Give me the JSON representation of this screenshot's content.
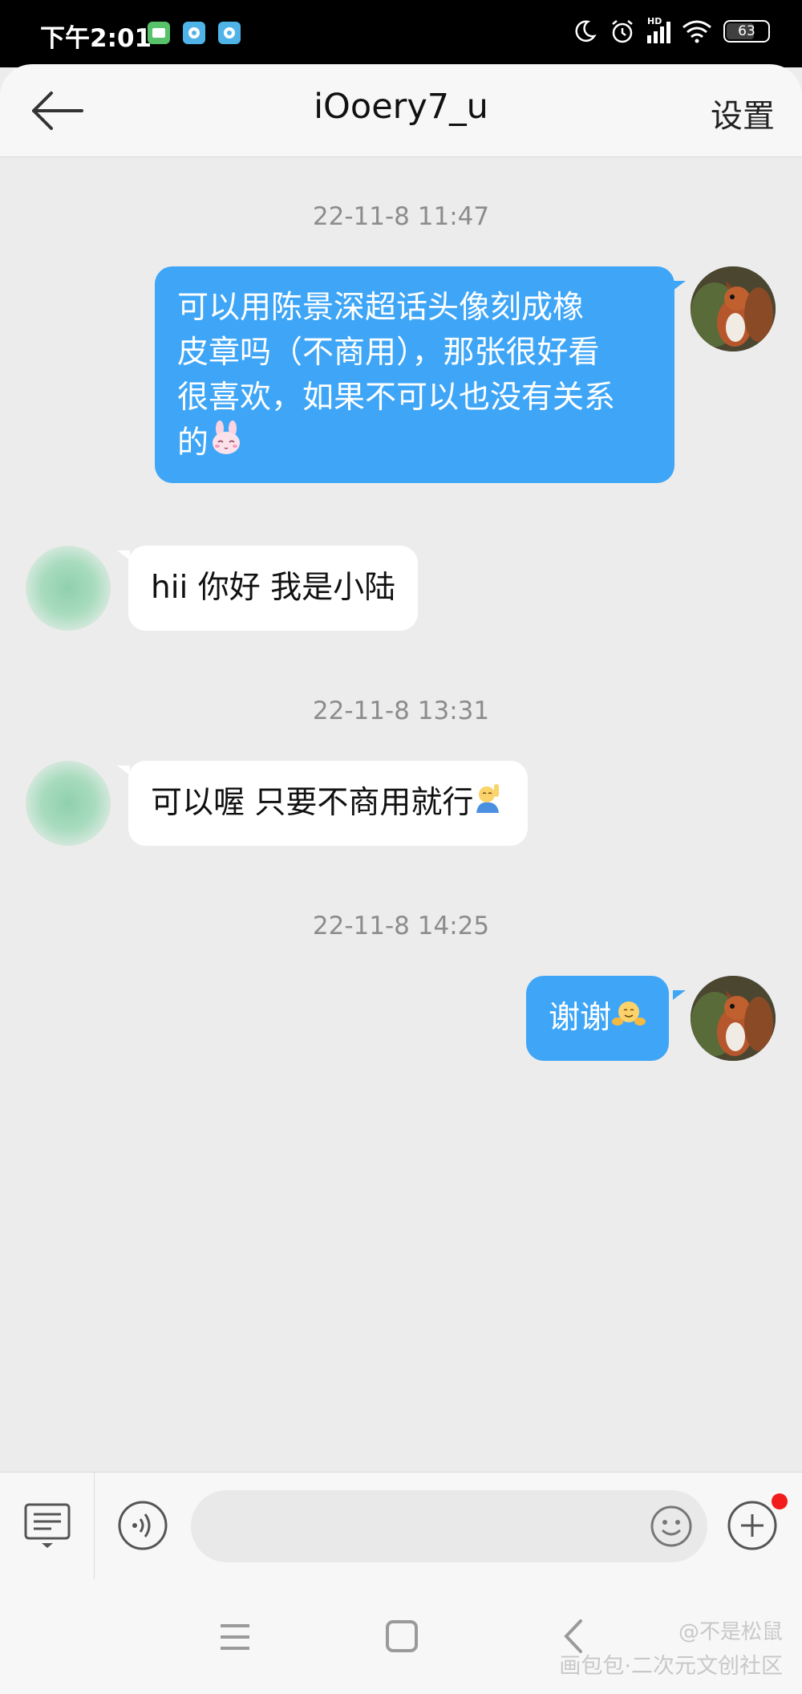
{
  "status_bar": {
    "time": "下午2:01",
    "battery": "63",
    "network_label": "HD",
    "battery_level": 0.63
  },
  "header": {
    "title": "iOoery7_u",
    "settings_label": "设置"
  },
  "messages": [
    {
      "type": "timestamp",
      "text": "22-11-8 11:47"
    },
    {
      "type": "outgoing",
      "lines": [
        "可以用陈景深超话头像刻成橡",
        "皮章吗（不商用），那张很好看",
        "很喜欢，如果不可以也没有关系",
        "的"
      ],
      "emoji": "bunny-face-emoji"
    },
    {
      "type": "incoming",
      "text": "hii 你好 我是小陆"
    },
    {
      "type": "timestamp",
      "text": "22-11-8 13:31"
    },
    {
      "type": "incoming",
      "text": "可以喔 只要不商用就行",
      "emoji": "person-raising-hand-emoji"
    },
    {
      "type": "timestamp",
      "text": "22-11-8 14:25"
    },
    {
      "type": "outgoing",
      "text": "谢谢",
      "emoji": "hugging-face-emoji"
    }
  ],
  "input_bar": {
    "placeholder": "",
    "has_notification": true
  },
  "watermark": {
    "line1": "@不是松鼠",
    "line2": "画包包·二次元文创社区"
  },
  "colors": {
    "outgoing_bubble": "#3fa6f7",
    "incoming_bubble": "#ffffff",
    "background": "#ececec",
    "notification_dot": "#f21c1c"
  }
}
